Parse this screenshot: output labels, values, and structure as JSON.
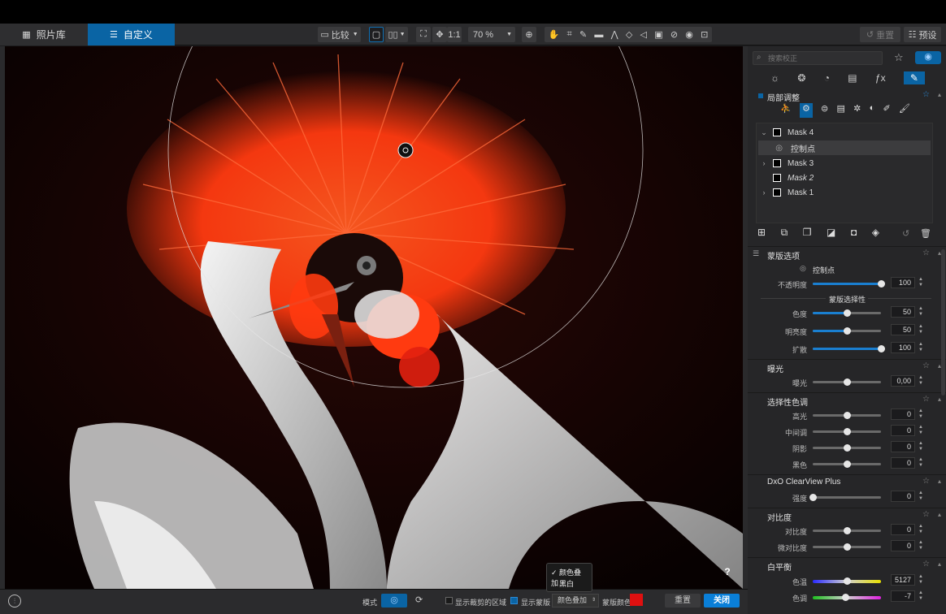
{
  "toolbar": {
    "library_label": "照片库",
    "customize_label": "自定义",
    "compare_label": "比较",
    "one_to_one": "1:1",
    "zoom_value": "70 %",
    "reset_label": "重置",
    "presets_label": "预设"
  },
  "panel": {
    "search_placeholder": "搜索校正",
    "local_adjust_title": "局部调整",
    "masks": [
      {
        "name": "Mask 4"
      },
      {
        "name": "控制点"
      },
      {
        "name": "Mask 3"
      },
      {
        "name": "Mask 2"
      },
      {
        "name": "Mask 1"
      }
    ],
    "mask_options": {
      "title": "蒙版选项",
      "control_point": "控制点",
      "opacity_label": "不透明度",
      "opacity_value": "100",
      "opacity_fraction": 1.0,
      "selectivity_title": "蒙版选择性",
      "sliders": [
        {
          "label": "色度",
          "value": "50",
          "fraction": 0.5
        },
        {
          "label": "明亮度",
          "value": "50",
          "fraction": 0.5
        },
        {
          "label": "扩散",
          "value": "100",
          "fraction": 1.0
        }
      ]
    },
    "exposure": {
      "title": "曝光",
      "label": "曝光",
      "value": "0,00"
    },
    "selective_tone": {
      "title": "选择性色调",
      "rows": [
        {
          "label": "高光",
          "value": "0"
        },
        {
          "label": "中间调",
          "value": "0"
        },
        {
          "label": "阴影",
          "value": "0"
        },
        {
          "label": "黑色",
          "value": "0"
        }
      ]
    },
    "clearview": {
      "title": "DxO ClearView Plus",
      "label": "强度",
      "value": "0"
    },
    "contrast": {
      "title": "对比度",
      "rows": [
        {
          "label": "对比度",
          "value": "0"
        },
        {
          "label": "微对比度",
          "value": "0"
        }
      ]
    },
    "white_balance": {
      "title": "白平衡",
      "rows": [
        {
          "label": "色温",
          "value": "5127"
        },
        {
          "label": "色调",
          "value": "-7"
        }
      ]
    }
  },
  "bottom": {
    "mode_label": "模式",
    "show_crop_label": "显示裁剪的区域",
    "show_mask_label": "显示蒙版",
    "overlay_select": "颜色叠加",
    "mask_color_label": "蒙版颜色",
    "mask_color": "#e01010",
    "reset_label": "重置",
    "close_label": "关闭",
    "help": "?",
    "dropdown": [
      {
        "label": "✓ 颜色叠加"
      },
      {
        "label": "黑白"
      }
    ]
  },
  "colors": {
    "accent": "#0a64a4",
    "mask_overlay": "#ff3a10"
  }
}
